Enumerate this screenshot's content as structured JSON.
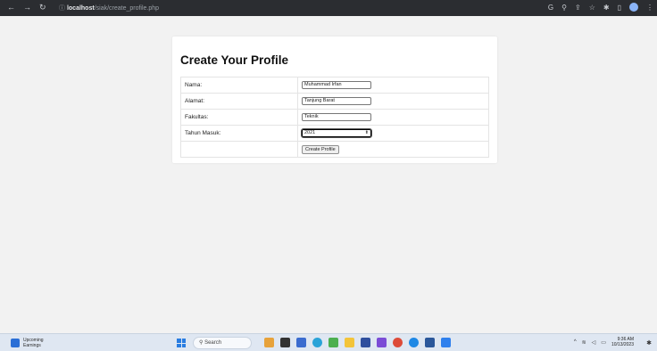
{
  "browser": {
    "url_host": "localhost",
    "url_path": "/siak/create_profile.php"
  },
  "form": {
    "title": "Create Your Profile",
    "fields": [
      {
        "label": "Nama:",
        "value": "Muhammad Irfan"
      },
      {
        "label": "Alamat:",
        "value": "Tanjung Barat"
      },
      {
        "label": "Fakultas:",
        "value": "Teknik"
      },
      {
        "label": "Tahun Masuk:",
        "value": "2021"
      }
    ],
    "submit_label": "Create Profile"
  },
  "taskbar": {
    "weather_title": "Upcoming",
    "weather_sub": "Earnings",
    "search_placeholder": "Search",
    "time": "9:36 AM",
    "date": "10/13/2023"
  },
  "colors": {
    "browser_bar": "#2b2d31",
    "page_bg": "#f2f2f2",
    "taskbar_bg": "#dfe7f2"
  }
}
